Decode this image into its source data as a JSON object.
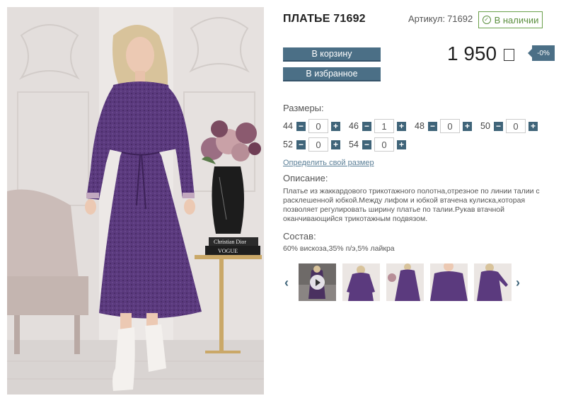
{
  "product": {
    "title": "ПЛАТЬЕ 71692",
    "sku_label": "Артикул:",
    "sku_value": "71692",
    "stock_label": "В наличии",
    "price": "1 950",
    "discount": "-0%"
  },
  "buttons": {
    "cart": "В корзину",
    "favorite": "В избранное"
  },
  "sizes": {
    "label": "Размеры:",
    "items": [
      {
        "size": "44",
        "qty": "0"
      },
      {
        "size": "46",
        "qty": "1"
      },
      {
        "size": "48",
        "qty": "0"
      },
      {
        "size": "50",
        "qty": "0"
      },
      {
        "size": "52",
        "qty": "0"
      },
      {
        "size": "54",
        "qty": "0"
      }
    ],
    "minus": "−",
    "plus": "+"
  },
  "size_link": "Определить свой размер",
  "description": {
    "label": "Описание:",
    "text": "Платье из жаккардового трикотажного полотна,отрезное по линии талии с расклешенной юбкой.Между лифом и юбкой втачена кулиска,которая позволяет регулировать ширину платье по талии.Рукав втачной оканчивающийся трикотажным подвязом."
  },
  "composition": {
    "label": "Состав:",
    "text": "60% вискоза,35% п/э,5% лайкра"
  },
  "gallery": {
    "prev_icon": "‹",
    "next_icon": "›",
    "thumb_count": 5
  },
  "photo_text": {
    "book_top": "Christian Dior",
    "book_bottom": "VOGUE"
  },
  "colors": {
    "accent": "#4b6f86",
    "stock_green": "#5b8f3e",
    "dress_purple": "#5b3a7e"
  }
}
